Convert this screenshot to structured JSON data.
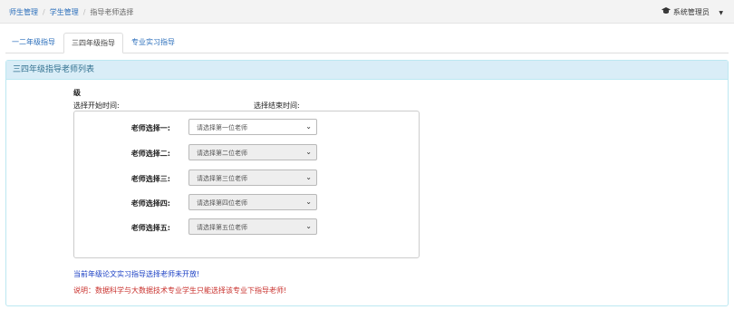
{
  "breadcrumb": [
    "师生管理",
    "学生管理",
    "指导老师选择"
  ],
  "user": {
    "name": "系统管理员",
    "icon": "graduation-cap-icon"
  },
  "tabs": [
    {
      "label": "一二年级指导",
      "active": false
    },
    {
      "label": "三四年级指导",
      "active": true
    },
    {
      "label": "专业实习指导",
      "active": false
    }
  ],
  "panel": {
    "title": "三四年级指导老师列表"
  },
  "grade_title": "级",
  "time": {
    "start_label": "选择开始时间:",
    "end_label": "选择结束时间:"
  },
  "selections": [
    {
      "label": "老师选择一:",
      "placeholder": "请选择第一位老师",
      "disabled": false
    },
    {
      "label": "老师选择二:",
      "placeholder": "请选择第二位老师",
      "disabled": true
    },
    {
      "label": "老师选择三:",
      "placeholder": "请选择第三位老师",
      "disabled": true
    },
    {
      "label": "老师选择四:",
      "placeholder": "请选择第四位老师",
      "disabled": true
    },
    {
      "label": "老师选择五:",
      "placeholder": "请选择第五位老师",
      "disabled": true
    }
  ],
  "notice": "当前年级论文实习指导选择老师未开放!",
  "explain": "说明：数据科学与大数据技术专业学生只能选择该专业下指导老师!",
  "colors": {
    "link": "#2a6ebb",
    "panel_head_bg": "#d9edf7",
    "notice": "#1a3fc4",
    "warning": "#c9302c"
  }
}
